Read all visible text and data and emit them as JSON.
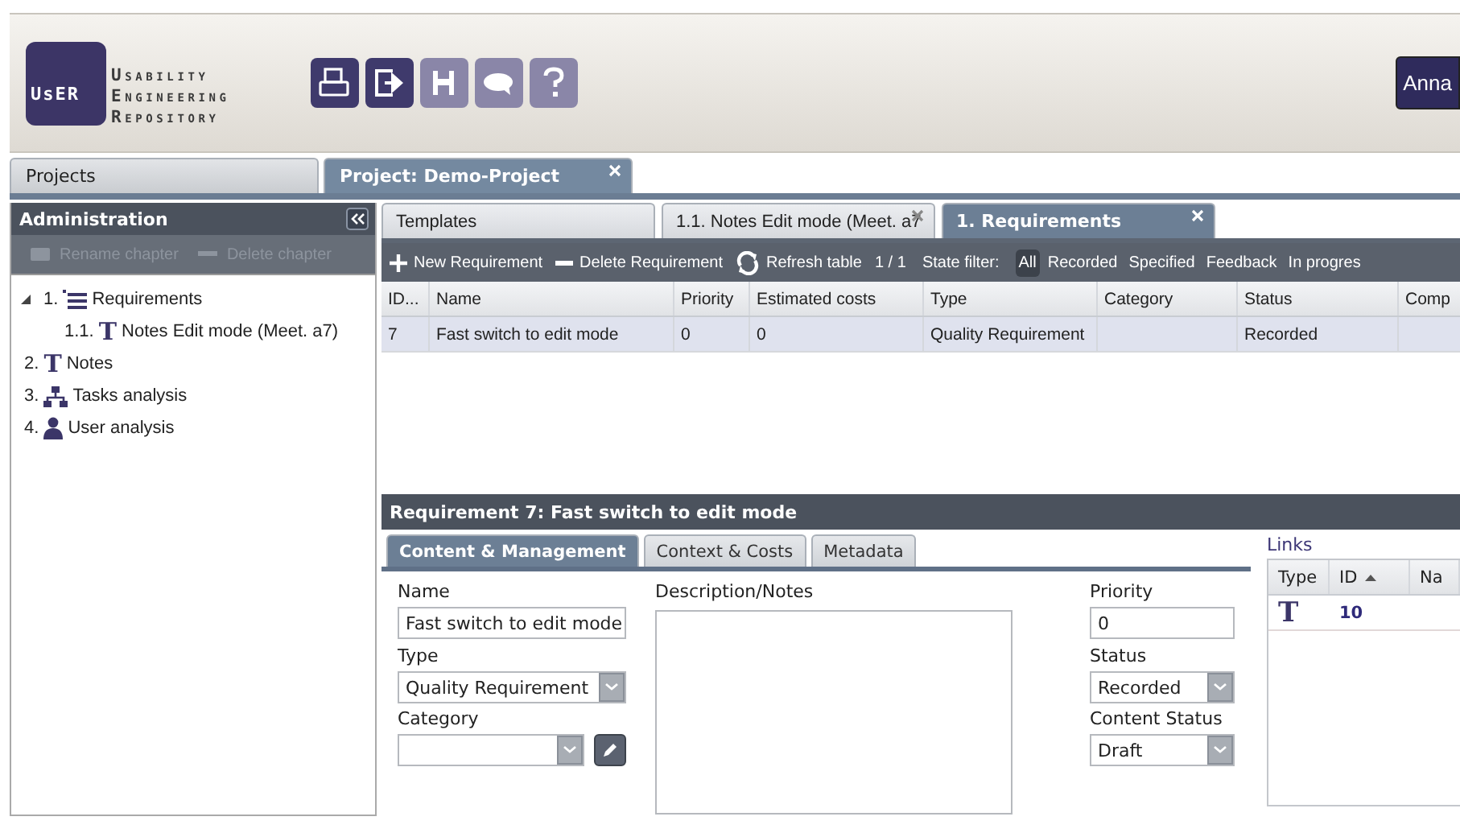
{
  "header": {
    "logo": {
      "mark": "UsER",
      "lines": [
        "Usability",
        "Engineering",
        "Repository"
      ]
    },
    "toolbar": [
      {
        "kind": "printer",
        "disabled": false
      },
      {
        "kind": "exit",
        "disabled": false
      },
      {
        "kind": "save",
        "disabled": true
      },
      {
        "kind": "comment",
        "disabled": true
      },
      {
        "kind": "help",
        "disabled": true
      }
    ],
    "user": "Anna"
  },
  "project_tabs": [
    {
      "label": "Projects",
      "selected": false,
      "closable": false
    },
    {
      "label": "Project: Demo-Project",
      "selected": true,
      "closable": true
    }
  ],
  "sidebar": {
    "title": "Administration",
    "actions": [
      {
        "label": "Rename chapter",
        "kind": "rename",
        "disabled": true
      },
      {
        "label": "Delete chapter",
        "kind": "delete",
        "disabled": true
      }
    ],
    "tree": [
      {
        "number": "1.",
        "label": "Requirements",
        "kind": "list",
        "expanded": true,
        "children": [
          {
            "number": "1.1.",
            "label": "Notes Edit mode (Meet. a7)",
            "kind": "text",
            "glyph": "T"
          }
        ]
      },
      {
        "number": "2.",
        "label": "Notes",
        "kind": "text",
        "glyph": "T"
      },
      {
        "number": "3.",
        "label": "Tasks analysis",
        "kind": "tasks"
      },
      {
        "number": "4.",
        "label": "User analysis",
        "kind": "person"
      }
    ]
  },
  "doc_tabs": [
    {
      "label": "Templates",
      "selected": false,
      "closable": false
    },
    {
      "label": "1.1. Notes Edit mode (Meet. a7",
      "selected": false,
      "closable": true
    },
    {
      "label": "1. Requirements",
      "selected": true,
      "closable": true
    }
  ],
  "table_toolbar": {
    "actions": [
      {
        "label": "New Requirement",
        "kind": "add"
      },
      {
        "label": "Delete Requirement",
        "kind": "delete"
      },
      {
        "label": "Refresh table",
        "kind": "refresh"
      }
    ],
    "page": "1 / 1",
    "filter_label": "State filter:",
    "filters": [
      {
        "label": "All",
        "selected": true
      },
      {
        "label": "Recorded",
        "selected": false
      },
      {
        "label": "Specified",
        "selected": false
      },
      {
        "label": "Feedback",
        "selected": false
      },
      {
        "label": "In progres",
        "selected": false
      }
    ]
  },
  "table": {
    "columns": [
      "ID...",
      "Name",
      "Priority",
      "Estimated costs",
      "Type",
      "Category",
      "Status",
      "Comp"
    ],
    "rows": [
      {
        "selected": true,
        "cells": [
          "7",
          "Fast switch to edit mode",
          "0",
          "0",
          "Quality Requirement",
          "",
          "Recorded",
          ""
        ]
      }
    ]
  },
  "detail": {
    "title": "Requirement 7: Fast switch to edit mode",
    "tabs": [
      {
        "label": "Content & Management",
        "selected": true
      },
      {
        "label": "Context & Costs",
        "selected": false
      },
      {
        "label": "Metadata",
        "selected": false
      }
    ],
    "columns": [
      [
        {
          "label": "Name",
          "kind": "text",
          "value": "Fast switch to edit mode"
        },
        {
          "label": "Type",
          "kind": "select",
          "value": "Quality Requirement"
        },
        {
          "label": "Category",
          "kind": "select_edit"
        }
      ],
      [
        {
          "label": "Description/Notes",
          "kind": "textarea"
        }
      ],
      [
        {
          "label": "Priority",
          "kind": "text",
          "value": "0"
        },
        {
          "label": "Status",
          "kind": "select",
          "value": "Recorded"
        },
        {
          "label": "Content Status",
          "kind": "select",
          "value": "Draft"
        }
      ]
    ],
    "links": {
      "title": "Links",
      "columns": [
        "Type",
        "ID",
        "Na"
      ],
      "rows": [
        {
          "glyph": "T",
          "id": "10"
        }
      ]
    }
  }
}
